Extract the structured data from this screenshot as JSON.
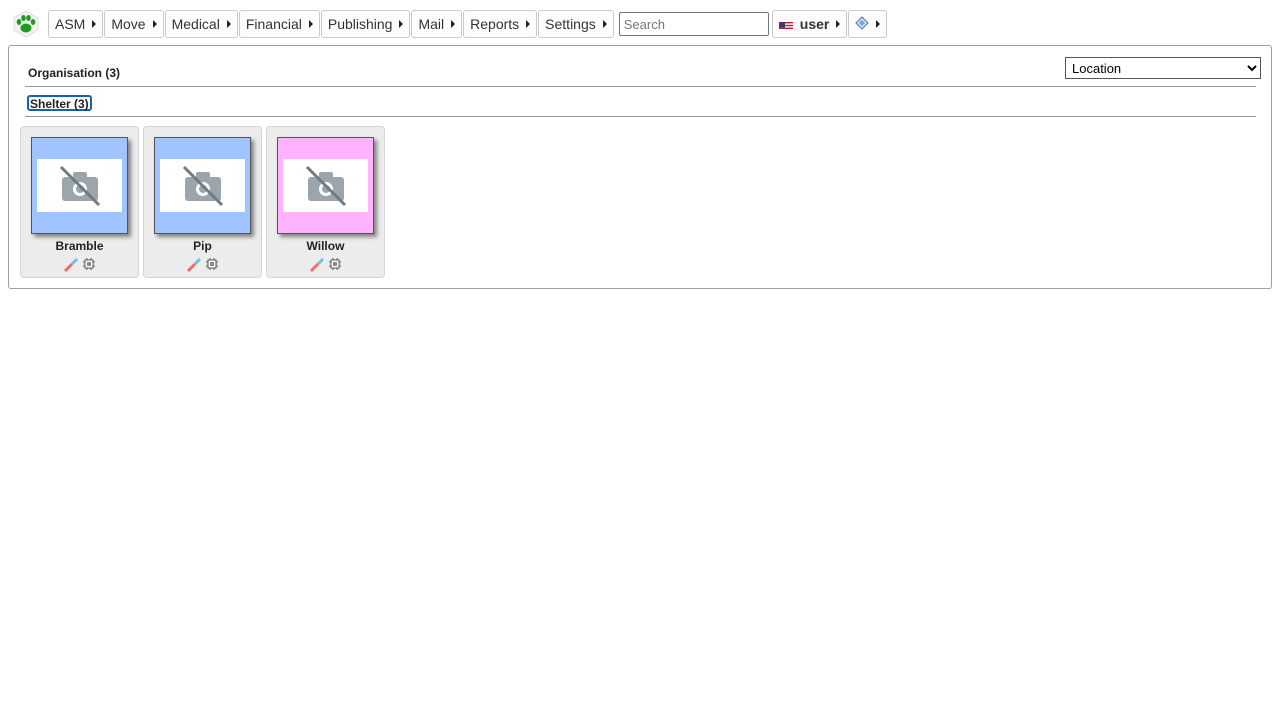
{
  "menu": {
    "items": [
      {
        "label": "ASM"
      },
      {
        "label": "Move"
      },
      {
        "label": "Medical"
      },
      {
        "label": "Financial"
      },
      {
        "label": "Publishing"
      },
      {
        "label": "Mail"
      },
      {
        "label": "Reports"
      },
      {
        "label": "Settings"
      }
    ],
    "search_placeholder": "Search",
    "user_label": "user"
  },
  "groups": {
    "organisation_label": "Organisation (3)",
    "shelter_label": "Shelter (3)"
  },
  "view_select": {
    "selected": "Location"
  },
  "animals": [
    {
      "name": "Bramble",
      "bg_color": "#a0c4ff"
    },
    {
      "name": "Pip",
      "bg_color": "#a0c4ff"
    },
    {
      "name": "Willow",
      "bg_color": "#ffb3ff"
    }
  ],
  "icons": {
    "logo": "paw-logo-icon",
    "no_photo": "no-camera-icon",
    "vaccination": "syringe-icon",
    "microchip": "microchip-icon",
    "flag": "us-flag-icon",
    "help": "diamond-help-icon"
  },
  "colors": {
    "logo_green": "#1e9a1e",
    "focus_blue": "#1a5fb4"
  }
}
